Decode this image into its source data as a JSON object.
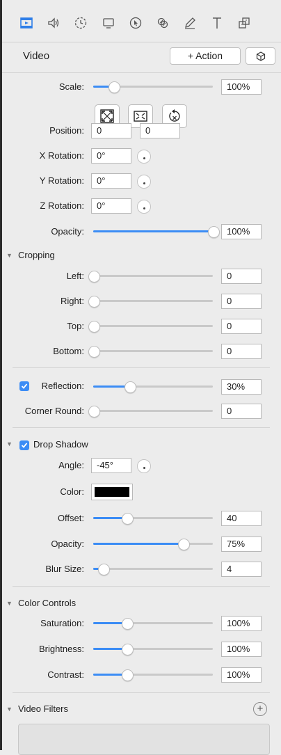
{
  "toolbar": {
    "icons": [
      "video-icon",
      "audio-icon",
      "timing-icon",
      "screen-icon",
      "cursor-icon",
      "effects-icon",
      "annotation-icon",
      "text-icon",
      "layout-icon"
    ]
  },
  "header": {
    "title": "Video",
    "action_label": "+ Action",
    "cube_icon": "cube-icon"
  },
  "scale": {
    "label": "Scale:",
    "value": "100%",
    "level": 0.17
  },
  "fit_buttons": [
    "fit-icon",
    "fill-icon",
    "reset-icon"
  ],
  "position": {
    "label": "Position:",
    "x": "0",
    "y": "0"
  },
  "x_rotation": {
    "label": "X Rotation:",
    "value": "0°"
  },
  "y_rotation": {
    "label": "Y Rotation:",
    "value": "0°"
  },
  "z_rotation": {
    "label": "Z Rotation:",
    "value": "0°"
  },
  "opacity": {
    "label": "Opacity:",
    "value": "100%",
    "level": 1.0
  },
  "cropping": {
    "title": "Cropping",
    "left": {
      "label": "Left:",
      "value": "0",
      "level": 0
    },
    "right": {
      "label": "Right:",
      "value": "0",
      "level": 0
    },
    "top": {
      "label": "Top:",
      "value": "0",
      "level": 0
    },
    "bottom": {
      "label": "Bottom:",
      "value": "0",
      "level": 0
    }
  },
  "reflection": {
    "label": "Reflection:",
    "value": "30%",
    "level": 0.3,
    "checked": true
  },
  "corner_round": {
    "label": "Corner Round:",
    "value": "0",
    "level": 0
  },
  "drop_shadow": {
    "title": "Drop Shadow",
    "checked": true,
    "angle": {
      "label": "Angle:",
      "value": "-45°"
    },
    "color": {
      "label": "Color:",
      "swatch": "#000000"
    },
    "offset": {
      "label": "Offset:",
      "value": "40",
      "level": 0.28
    },
    "opacity": {
      "label": "Opacity:",
      "value": "75%",
      "level": 0.75
    },
    "blur": {
      "label": "Blur Size:",
      "value": "4",
      "level": 0.08
    }
  },
  "color_controls": {
    "title": "Color Controls",
    "saturation": {
      "label": "Saturation:",
      "value": "100%",
      "level": 0.28
    },
    "brightness": {
      "label": "Brightness:",
      "value": "100%",
      "level": 0.28
    },
    "contrast": {
      "label": "Contrast:",
      "value": "100%",
      "level": 0.28
    }
  },
  "video_filters": {
    "title": "Video Filters",
    "add_icon": "plus-circle-icon"
  },
  "colors": {
    "accent": "#3b8cf5",
    "selected_tab": "#2f7fe8"
  }
}
